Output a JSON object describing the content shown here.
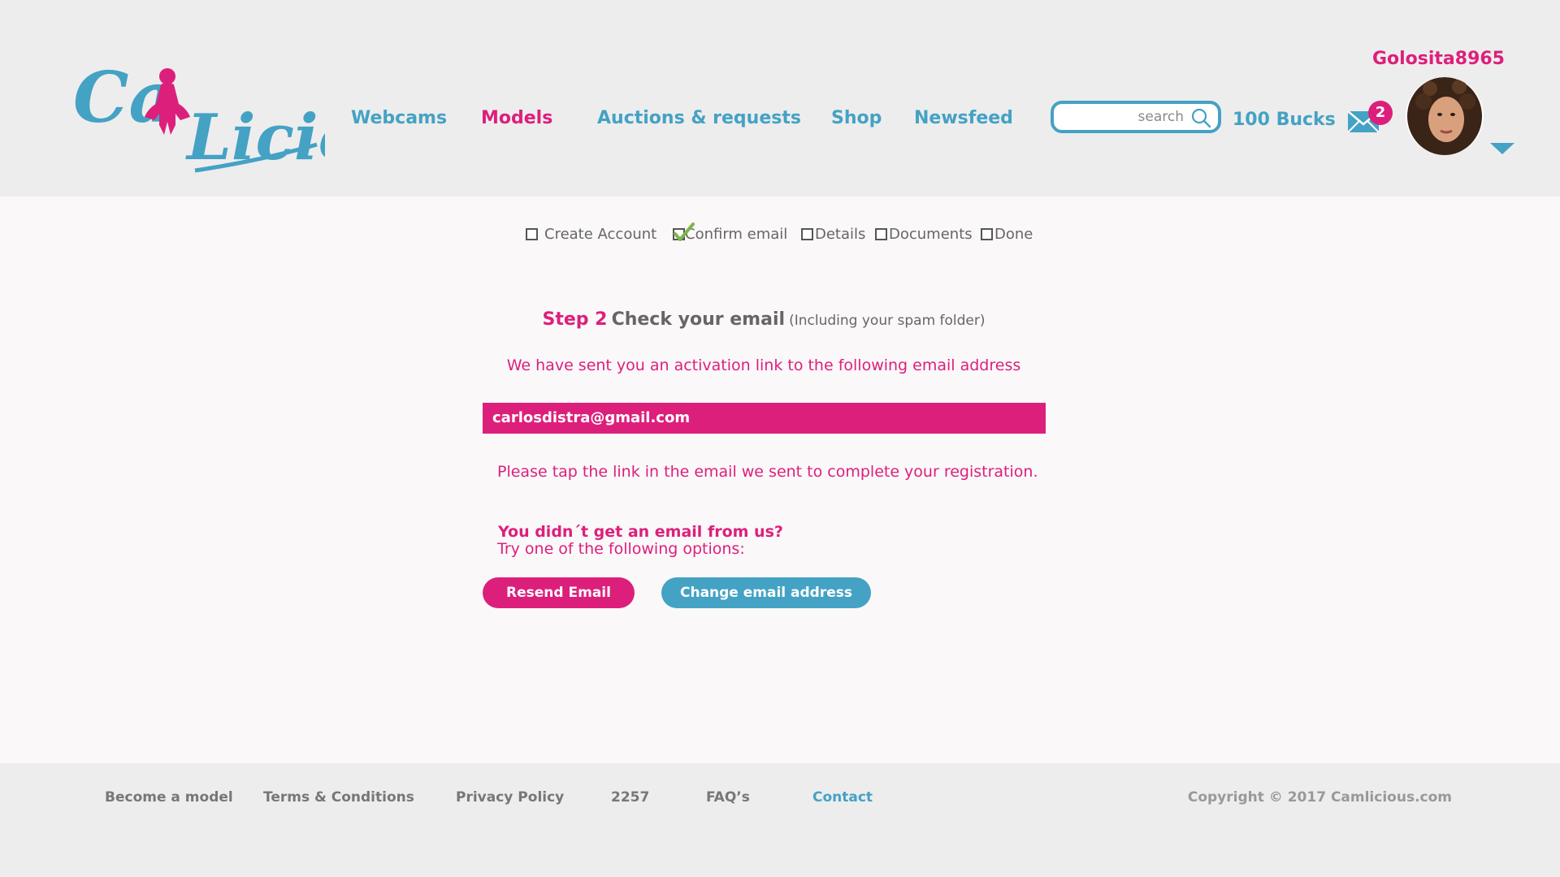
{
  "brand": {
    "logo_text": "CamLicious",
    "colors": {
      "pink": "#dd1f7c",
      "blue": "#44a2c4",
      "check_green": "#7ab648"
    }
  },
  "nav": {
    "items": [
      {
        "label": "Webcams",
        "active": false
      },
      {
        "label": "Models",
        "active": true
      },
      {
        "label": "Auctions & requests",
        "active": false
      },
      {
        "label": "Shop",
        "active": false
      },
      {
        "label": "Newsfeed",
        "active": false
      }
    ]
  },
  "search": {
    "placeholder": "search",
    "icon": "search-icon"
  },
  "account": {
    "username": "Golosita8965",
    "bucks": "100 Bucks",
    "unread_messages": "2",
    "mail_icon": "envelope-icon",
    "menu_icon": "caret-down-icon"
  },
  "steps": [
    {
      "label": "Create Account",
      "checked": false
    },
    {
      "label": "Confirm email",
      "checked": true
    },
    {
      "label": "Details",
      "checked": false
    },
    {
      "label": "Documents",
      "checked": false
    },
    {
      "label": "Done",
      "checked": false
    }
  ],
  "main": {
    "step_number": "Step 2",
    "step_heading": "Check your email",
    "step_note": "(Including your spam folder)",
    "sent_message": "We have sent you an activation link to the following email address",
    "email": "carlosdistra@gmail.com",
    "tap_message": "Please tap the link in the email we sent to complete your registration.",
    "no_email_heading": "You didn´t get an email from us?",
    "try_options": "Try one of the following options:",
    "resend_label": "Resend Email",
    "change_label": "Change email address"
  },
  "footer": {
    "links": [
      {
        "label": "Become a model",
        "accent": false
      },
      {
        "label": "Terms & Conditions",
        "accent": false
      },
      {
        "label": "Privacy Policy",
        "accent": false
      },
      {
        "label": "2257",
        "accent": false
      },
      {
        "label": "FAQ’s",
        "accent": false
      },
      {
        "label": "Contact",
        "accent": true
      }
    ],
    "copyright": "Copyright © 2017 Camlicious.com"
  }
}
